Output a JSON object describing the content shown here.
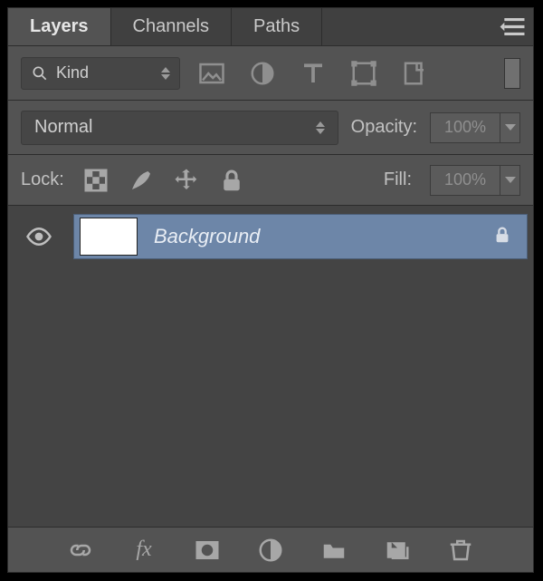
{
  "tabs": [
    {
      "label": "Layers",
      "active": true
    },
    {
      "label": "Channels",
      "active": false
    },
    {
      "label": "Paths",
      "active": false
    }
  ],
  "filter": {
    "kind_label": "Kind",
    "icons": [
      "image-filter-icon",
      "adjustment-filter-icon",
      "type-filter-icon",
      "shape-filter-icon",
      "smart-filter-icon"
    ]
  },
  "blend": {
    "mode": "Normal",
    "opacity_label": "Opacity:",
    "opacity_value": "100%"
  },
  "lock": {
    "label": "Lock:",
    "fill_label": "Fill:",
    "fill_value": "100%"
  },
  "layers": [
    {
      "name": "Background",
      "visible": true,
      "locked": true,
      "selected": true
    }
  ],
  "bottom_icons": [
    "link-icon",
    "fx-icon",
    "mask-icon",
    "adjustment-icon",
    "group-icon",
    "new-layer-icon",
    "trash-icon"
  ]
}
